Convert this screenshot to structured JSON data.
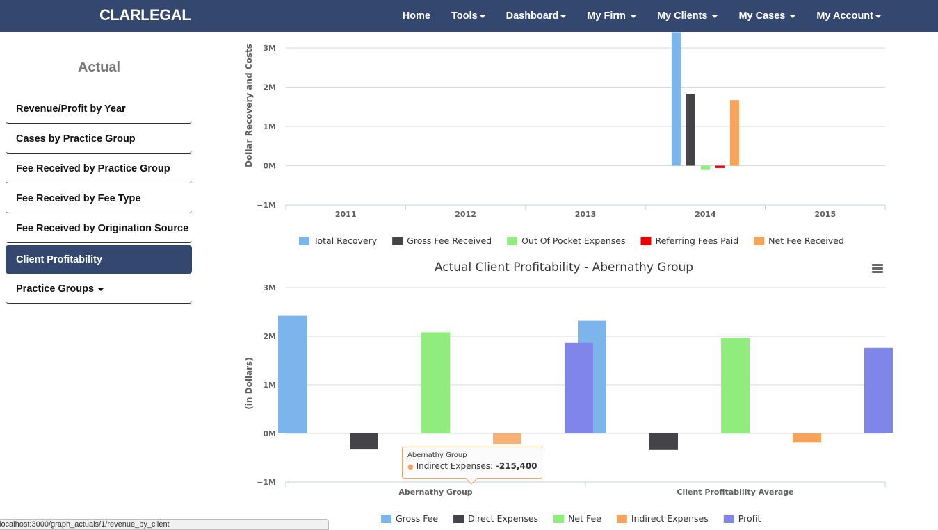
{
  "navbar": {
    "brand": "CLARLEGAL",
    "items": [
      {
        "label": "Home",
        "dropdown": false
      },
      {
        "label": "Tools",
        "dropdown": true
      },
      {
        "label": "Dashboard",
        "dropdown": true
      },
      {
        "label": "My Firm",
        "dropdown": true
      },
      {
        "label": "My Clients",
        "dropdown": true
      },
      {
        "label": "My Cases",
        "dropdown": true
      },
      {
        "label": "My Account",
        "dropdown": true
      }
    ],
    "bg_color": "#34486f"
  },
  "sidebar": {
    "title": "Actual",
    "items": [
      {
        "label": "Revenue/Profit by Year",
        "active": false
      },
      {
        "label": "Cases by Practice Group",
        "active": false
      },
      {
        "label": "Fee Received by Practice Group",
        "active": false
      },
      {
        "label": "Fee Received by Fee Type",
        "active": false
      },
      {
        "label": "Fee Received by Origination Source",
        "active": false
      },
      {
        "label": "Client Profitability",
        "active": true
      },
      {
        "label": "Practice Groups",
        "active": false,
        "dropdown": true
      }
    ]
  },
  "status_bar": {
    "text": "localhost:3000/graph_actuals/1/revenue_by_client"
  },
  "tooltip": {
    "title": "Abernathy Group",
    "series": "Indirect Expenses",
    "value": "-215,400"
  },
  "chart_data": [
    {
      "type": "bar",
      "title": "",
      "ylabel": "Dollar Recovery and Costs",
      "categories": [
        "2011",
        "2012",
        "2013",
        "2014",
        "2015"
      ],
      "ylim": [
        -1000000,
        3000000
      ],
      "yticks": [
        "3M",
        "2M",
        "1M",
        "0M",
        "−1M"
      ],
      "grid": true,
      "legend": "bottom",
      "series": [
        {
          "name": "Total Recovery",
          "color": "#7cb5ec",
          "values": [
            0,
            0,
            0,
            3400000,
            0
          ]
        },
        {
          "name": "Gross Fee Received",
          "color": "#434348",
          "values": [
            0,
            0,
            0,
            1830000,
            0
          ]
        },
        {
          "name": "Out Of Pocket Expenses",
          "color": "#90ed7d",
          "values": [
            0,
            0,
            0,
            -110000,
            0
          ]
        },
        {
          "name": "Referring Fees Paid",
          "color": "#f00000",
          "values": [
            0,
            0,
            0,
            -60000,
            0
          ]
        },
        {
          "name": "Net Fee Received",
          "color": "#f7a35c",
          "values": [
            0,
            0,
            0,
            1670000,
            0
          ]
        }
      ]
    },
    {
      "type": "bar",
      "title": "Actual Client Profitability - Abernathy Group",
      "ylabel": "(in Dollars)",
      "categories": [
        "Abernathy Group",
        "Client Profitability Average"
      ],
      "ylim": [
        -1000000,
        3000000
      ],
      "yticks": [
        "3M",
        "2M",
        "1M",
        "0M",
        "−1M"
      ],
      "grid": true,
      "legend": "bottom",
      "series": [
        {
          "name": "Gross Fee",
          "color": "#7cb5ec",
          "values": [
            2420000,
            2320000
          ]
        },
        {
          "name": "Direct Expenses",
          "color": "#434348",
          "values": [
            -330000,
            -340000
          ]
        },
        {
          "name": "Net Fee",
          "color": "#90ed7d",
          "values": [
            2080000,
            1970000
          ]
        },
        {
          "name": "Indirect Expenses",
          "color": "#f7a35c",
          "values": [
            -215400,
            -190000
          ]
        },
        {
          "name": "Profit",
          "color": "#8085e9",
          "values": [
            1860000,
            1760000
          ]
        }
      ]
    }
  ]
}
